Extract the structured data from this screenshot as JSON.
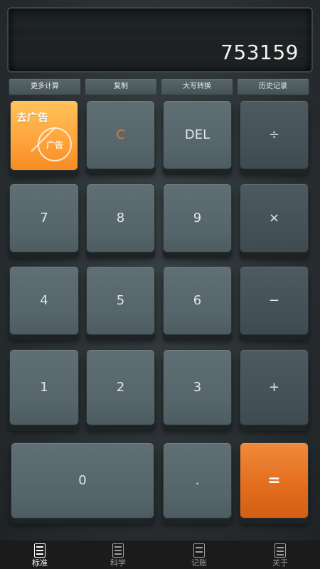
{
  "display": {
    "value": "753159"
  },
  "functions": [
    "更多计算",
    "复制",
    "大写转换",
    "历史记录"
  ],
  "ad": {
    "title": "去广告",
    "stamp": "广告"
  },
  "keys": {
    "clear": "C",
    "del": "DEL",
    "divide": "÷",
    "seven": "7",
    "eight": "8",
    "nine": "9",
    "multiply": "×",
    "four": "4",
    "five": "5",
    "six": "6",
    "minus": "−",
    "one": "1",
    "two": "2",
    "three": "3",
    "plus": "+",
    "zero": "0",
    "dot": ".",
    "equals": "="
  },
  "tabs": [
    {
      "label": "标准",
      "icon": "calculator-icon",
      "active": true
    },
    {
      "label": "科学",
      "icon": "scientific-calculator-icon",
      "active": false
    },
    {
      "label": "记账",
      "icon": "ledger-icon",
      "active": false
    },
    {
      "label": "关于",
      "icon": "about-icon",
      "active": false
    }
  ],
  "colors": {
    "accent_orange": "#e26c1d",
    "ad_orange": "#ffa23a",
    "clear_text": "#e07a3a"
  }
}
